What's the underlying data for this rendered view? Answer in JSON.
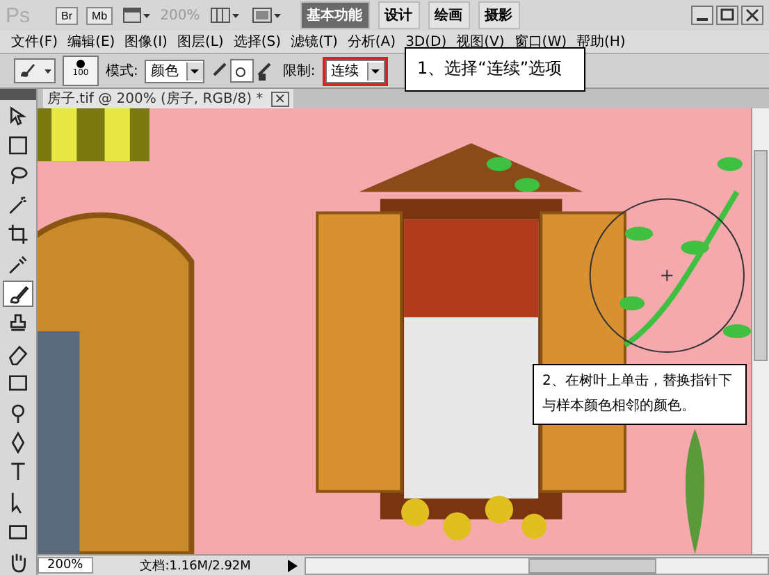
{
  "app_bar": {
    "logo": "Ps",
    "launchers": [
      "Br",
      "Mb"
    ],
    "zoom": "200%",
    "workspaces": [
      {
        "label": "基本功能",
        "selected": true
      },
      {
        "label": "设计",
        "selected": false
      },
      {
        "label": "绘画",
        "selected": false
      },
      {
        "label": "摄影",
        "selected": false
      }
    ]
  },
  "menu": [
    "文件(F)",
    "编辑(E)",
    "图像(I)",
    "图层(L)",
    "选择(S)",
    "滤镜(T)",
    "分析(A)",
    "3D(D)",
    "视图(V)",
    "窗口(W)",
    "帮助(H)"
  ],
  "options": {
    "brush_size": "100",
    "mode": {
      "label": "模式:",
      "value": "颜色"
    },
    "limit": {
      "label": "限制:",
      "value": "连续",
      "highlighted": true
    }
  },
  "document_tab": {
    "title": "房子.tif @ 200% (房子, RGB/8) *",
    "close": "×"
  },
  "tools": [
    {
      "kind": "move",
      "selected": false
    },
    {
      "kind": "marquee",
      "selected": false
    },
    {
      "kind": "lasso",
      "selected": false
    },
    {
      "kind": "wand",
      "selected": false
    },
    {
      "kind": "crop",
      "selected": false
    },
    {
      "kind": "eyedropper",
      "selected": false
    },
    {
      "kind": "brush",
      "selected": true
    },
    {
      "kind": "stamp",
      "selected": false
    },
    {
      "kind": "eraser",
      "selected": false
    },
    {
      "kind": "gradient",
      "selected": false
    },
    {
      "kind": "dodge",
      "selected": false
    },
    {
      "kind": "pen",
      "selected": false
    },
    {
      "kind": "text",
      "selected": false
    },
    {
      "kind": "select",
      "selected": false
    },
    {
      "kind": "shape",
      "selected": false
    },
    {
      "kind": "hand",
      "selected": false
    }
  ],
  "callouts": [
    {
      "text": "1、选择“连续”选项"
    },
    {
      "text": "2、在树叶上单击，替换指针下与样本颜色相邻的颜色。"
    }
  ],
  "status_bar": {
    "zoom": "200%",
    "doc_info": "文档:1.16M/2.92M"
  }
}
